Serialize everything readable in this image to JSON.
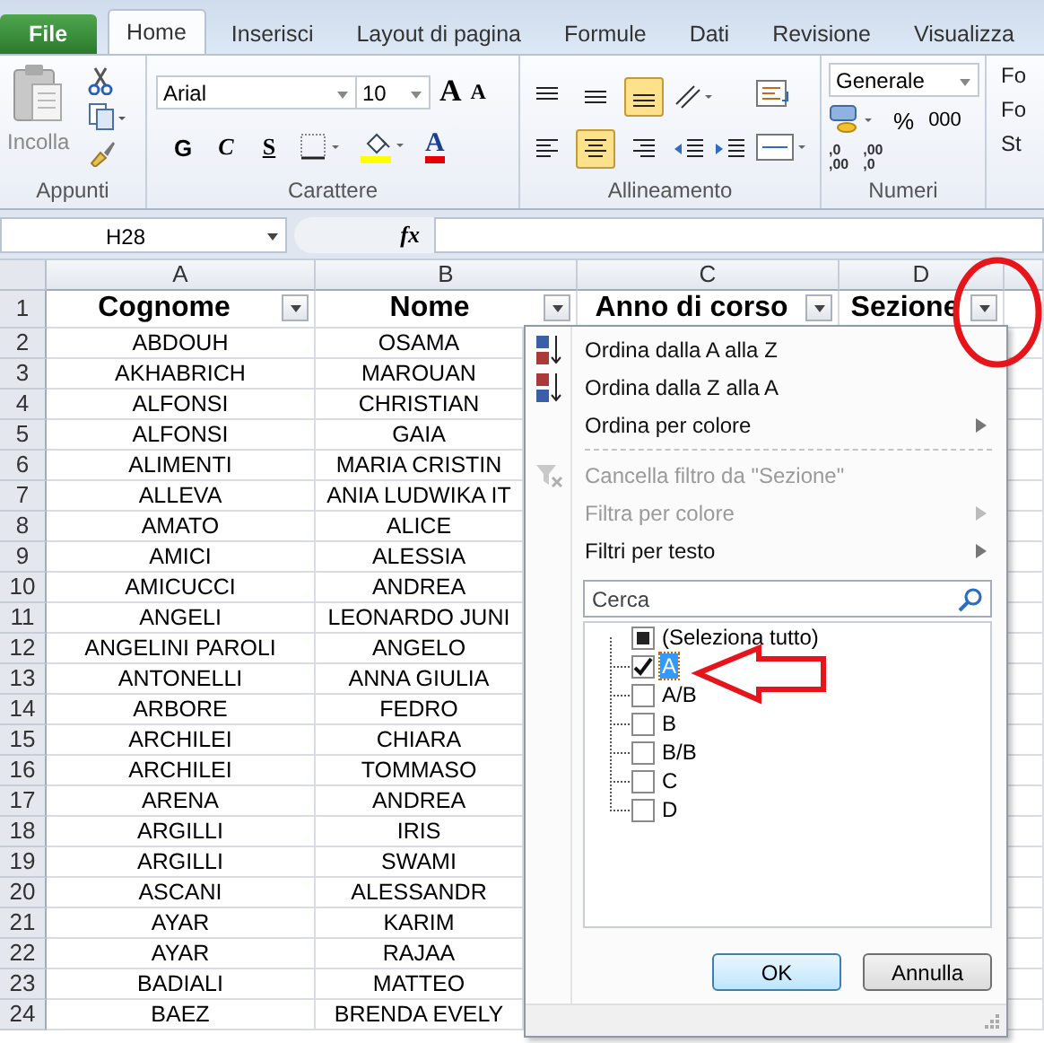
{
  "ribbon_tabs": [
    {
      "label": "File",
      "kind": "file",
      "selected": false
    },
    {
      "label": "Home",
      "kind": "tab",
      "selected": true
    },
    {
      "label": "Inserisci",
      "kind": "tab",
      "selected": false
    },
    {
      "label": "Layout di pagina",
      "kind": "tab",
      "selected": false
    },
    {
      "label": "Formule",
      "kind": "tab",
      "selected": false
    },
    {
      "label": "Dati",
      "kind": "tab",
      "selected": false
    },
    {
      "label": "Revisione",
      "kind": "tab",
      "selected": false
    },
    {
      "label": "Visualizza",
      "kind": "tab",
      "selected": false
    }
  ],
  "clipboard": {
    "paste_label": "Incolla",
    "group_label": "Appunti"
  },
  "font": {
    "name": "Arial",
    "size": "10",
    "grow": "A",
    "shrink": "A",
    "bold": "G",
    "italic": "C",
    "underline": "S",
    "font_color": "A",
    "group_label": "Carattere"
  },
  "alignment": {
    "vertical": [
      {
        "kind": "top",
        "selected": false
      },
      {
        "kind": "middle",
        "selected": false
      },
      {
        "kind": "bottom",
        "selected": true
      }
    ],
    "horizontal": [
      {
        "kind": "left",
        "selected": false
      },
      {
        "kind": "center",
        "selected": true
      },
      {
        "kind": "right",
        "selected": false
      }
    ],
    "group_label": "Allineamento"
  },
  "number": {
    "format": "Generale",
    "percent": "%",
    "thousands": "000",
    "increase_decimal": [
      ",0",
      ",00"
    ],
    "decrease_decimal": [
      ",00",
      ",0"
    ],
    "group_label": "Numeri"
  },
  "styles": {
    "items": [
      "Fo",
      "Fo",
      "St"
    ]
  },
  "formula_bar": {
    "name_box": "H28",
    "function_label": "fx"
  },
  "sheet": {
    "columns": [
      "A",
      "B",
      "C",
      "D"
    ],
    "header": {
      "number": "1",
      "cells": [
        "Cognome",
        "Nome",
        "Anno di corso",
        "Sezione"
      ]
    },
    "rows": [
      {
        "number": "2",
        "cells": [
          "ABDOUH",
          "OSAMA"
        ]
      },
      {
        "number": "3",
        "cells": [
          "AKHABRICH",
          "MAROUAN"
        ]
      },
      {
        "number": "4",
        "cells": [
          "ALFONSI",
          "CHRISTIAN"
        ]
      },
      {
        "number": "5",
        "cells": [
          "ALFONSI",
          "GAIA"
        ]
      },
      {
        "number": "6",
        "cells": [
          "ALIMENTI",
          "MARIA CRISTIN"
        ]
      },
      {
        "number": "7",
        "cells": [
          "ALLEVA",
          "ANIA LUDWIKA IT"
        ]
      },
      {
        "number": "8",
        "cells": [
          "AMATO",
          "ALICE"
        ]
      },
      {
        "number": "9",
        "cells": [
          "AMICI",
          "ALESSIA"
        ]
      },
      {
        "number": "10",
        "cells": [
          "AMICUCCI",
          "ANDREA"
        ]
      },
      {
        "number": "11",
        "cells": [
          "ANGELI",
          "LEONARDO JUNI"
        ]
      },
      {
        "number": "12",
        "cells": [
          "ANGELINI PAROLI",
          "ANGELO"
        ]
      },
      {
        "number": "13",
        "cells": [
          "ANTONELLI",
          "ANNA GIULIA"
        ]
      },
      {
        "number": "14",
        "cells": [
          "ARBORE",
          "FEDRO"
        ]
      },
      {
        "number": "15",
        "cells": [
          "ARCHILEI",
          "CHIARA"
        ]
      },
      {
        "number": "16",
        "cells": [
          "ARCHILEI",
          "TOMMASO"
        ]
      },
      {
        "number": "17",
        "cells": [
          "ARENA",
          "ANDREA"
        ]
      },
      {
        "number": "18",
        "cells": [
          "ARGILLI",
          "IRIS"
        ]
      },
      {
        "number": "19",
        "cells": [
          "ARGILLI",
          "SWAMI"
        ]
      },
      {
        "number": "20",
        "cells": [
          "ASCANI",
          "ALESSANDR"
        ]
      },
      {
        "number": "21",
        "cells": [
          "AYAR",
          "KARIM"
        ]
      },
      {
        "number": "22",
        "cells": [
          "AYAR",
          "RAJAA"
        ]
      },
      {
        "number": "23",
        "cells": [
          "BADIALI",
          "MATTEO"
        ]
      },
      {
        "number": "24",
        "cells": [
          "BAEZ",
          "BRENDA EVELY"
        ]
      }
    ]
  },
  "filter_menu": {
    "items": [
      {
        "label": "Ordina dalla A alla Z",
        "kind": "sort_az",
        "disabled": false,
        "submenu": false
      },
      {
        "label": "Ordina dalla Z alla A",
        "kind": "sort_za",
        "disabled": false,
        "submenu": false
      },
      {
        "label": "Ordina per colore",
        "kind": "plain",
        "disabled": false,
        "submenu": true
      },
      {
        "label": "Cancella filtro da \"Sezione\"",
        "kind": "clear_filter",
        "disabled": true,
        "submenu": false
      },
      {
        "label": "Filtra per colore",
        "kind": "plain",
        "disabled": true,
        "submenu": true
      },
      {
        "label": "Filtri per testo",
        "kind": "plain",
        "disabled": false,
        "submenu": true
      }
    ],
    "search": {
      "placeholder": "Cerca"
    },
    "select_all": {
      "label": "(Seleziona tutto)",
      "indeterminate": true
    },
    "values": [
      {
        "label": "A",
        "checked": true,
        "selected": true
      },
      {
        "label": "A/B",
        "checked": false,
        "selected": false
      },
      {
        "label": "B",
        "checked": false,
        "selected": false
      },
      {
        "label": "B/B",
        "checked": false,
        "selected": false
      },
      {
        "label": "C",
        "checked": false,
        "selected": false
      },
      {
        "label": "D",
        "checked": false,
        "selected": false
      }
    ],
    "buttons": [
      "OK",
      "Annulla"
    ]
  }
}
